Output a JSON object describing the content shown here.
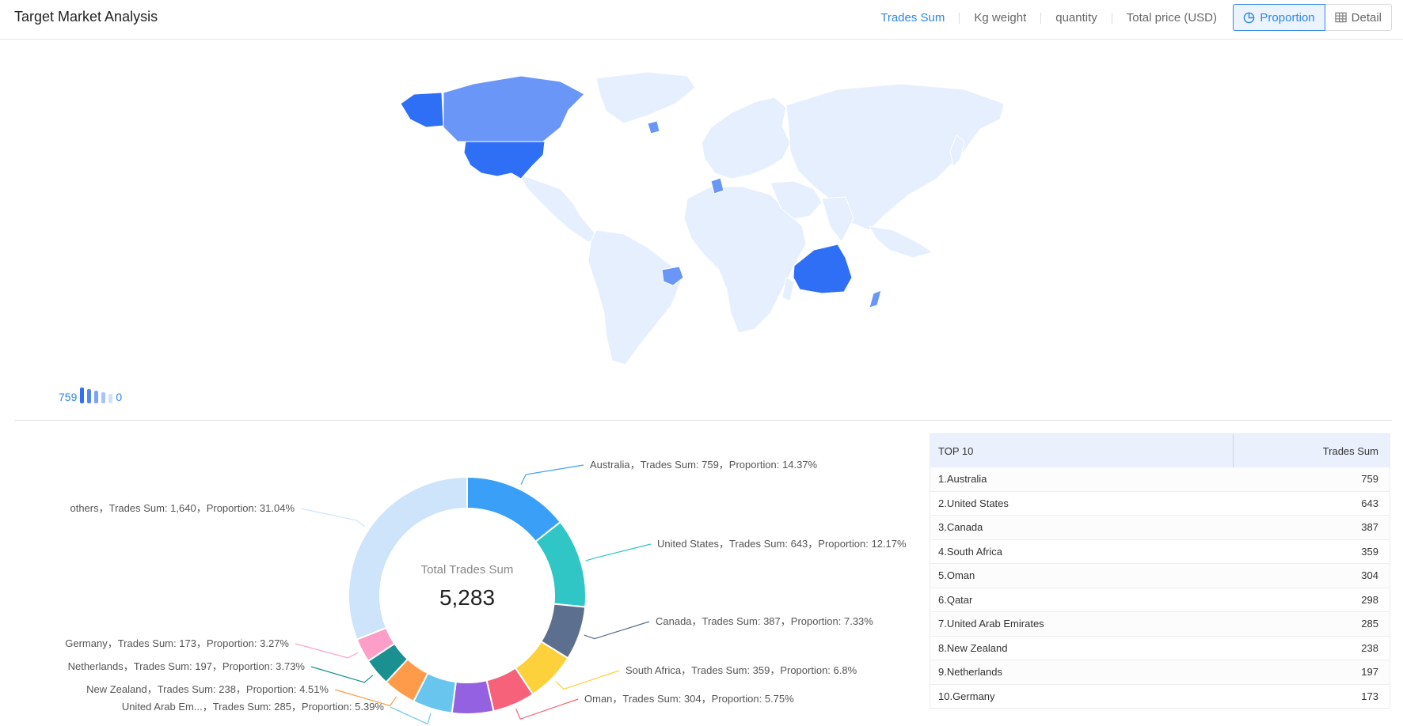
{
  "page_title": "Target Market Analysis",
  "metric_tabs": [
    {
      "label": "Trades Sum",
      "active": true
    },
    {
      "label": "Kg weight",
      "active": false
    },
    {
      "label": "quantity",
      "active": false
    },
    {
      "label": "Total price (USD)",
      "active": false
    }
  ],
  "view_toggle": {
    "proportion_label": "Proportion",
    "detail_label": "Detail"
  },
  "map_legend": {
    "max": "759",
    "min": "0"
  },
  "colors": {
    "accent": "#2f86ea",
    "map_base": "#e6effd",
    "map_high": "#2f6ff5",
    "map_mid": "#6a96f7"
  },
  "chart_data": {
    "type": "pie",
    "center_label": "Total Trades Sum",
    "center_value": "5,283",
    "slices": [
      {
        "name": "Australia",
        "value": 759,
        "proportion": "14.37%",
        "label": "Australia，Trades Sum: 759，Proportion: 14.37%",
        "color": "#3aa0f7"
      },
      {
        "name": "United States",
        "value": 643,
        "proportion": "12.17%",
        "label": "United States，Trades Sum: 643，Proportion: 12.17%",
        "color": "#30c6c6"
      },
      {
        "name": "Canada",
        "value": 387,
        "proportion": "7.33%",
        "label": "Canada，Trades Sum: 387，Proportion: 7.33%",
        "color": "#5d6f8e"
      },
      {
        "name": "South Africa",
        "value": 359,
        "proportion": "6.8%",
        "label": "South Africa，Trades Sum: 359，Proportion: 6.8%",
        "color": "#fdd13b"
      },
      {
        "name": "Oman",
        "value": 304,
        "proportion": "5.75%",
        "label": "Oman，Trades Sum: 304，Proportion: 5.75%",
        "color": "#f56279"
      },
      {
        "name": "Qatar",
        "value": 298,
        "proportion": "",
        "label": "",
        "color": "#9462e0"
      },
      {
        "name": "United Arab Emirates",
        "value": 285,
        "proportion": "5.39%",
        "label": "United Arab Em...，Trades Sum: 285，Proportion: 5.39%",
        "color": "#68c6ee"
      },
      {
        "name": "New Zealand",
        "value": 238,
        "proportion": "4.51%",
        "label": "New Zealand，Trades Sum: 238，Proportion: 4.51%",
        "color": "#fd9b4a"
      },
      {
        "name": "Netherlands",
        "value": 197,
        "proportion": "3.73%",
        "label": "Netherlands，Trades Sum: 197，Proportion: 3.73%",
        "color": "#1a9190"
      },
      {
        "name": "Germany",
        "value": 173,
        "proportion": "3.27%",
        "label": "Germany，Trades Sum: 173，Proportion: 3.27%",
        "color": "#fb9fc9"
      },
      {
        "name": "others",
        "value": 1640,
        "proportion": "31.04%",
        "label": "others，Trades Sum: 1,640，Proportion: 31.04%",
        "color": "#cde4fb"
      }
    ]
  },
  "top10": {
    "header_left": "TOP 10",
    "header_right": "Trades Sum",
    "rows": [
      {
        "name": "1.Australia",
        "value": "759"
      },
      {
        "name": "2.United States",
        "value": "643"
      },
      {
        "name": "3.Canada",
        "value": "387"
      },
      {
        "name": "4.South Africa",
        "value": "359"
      },
      {
        "name": "5.Oman",
        "value": "304"
      },
      {
        "name": "6.Qatar",
        "value": "298"
      },
      {
        "name": "7.United Arab Emirates",
        "value": "285"
      },
      {
        "name": "8.New Zealand",
        "value": "238"
      },
      {
        "name": "9.Netherlands",
        "value": "197"
      },
      {
        "name": "10.Germany",
        "value": "173"
      }
    ]
  }
}
